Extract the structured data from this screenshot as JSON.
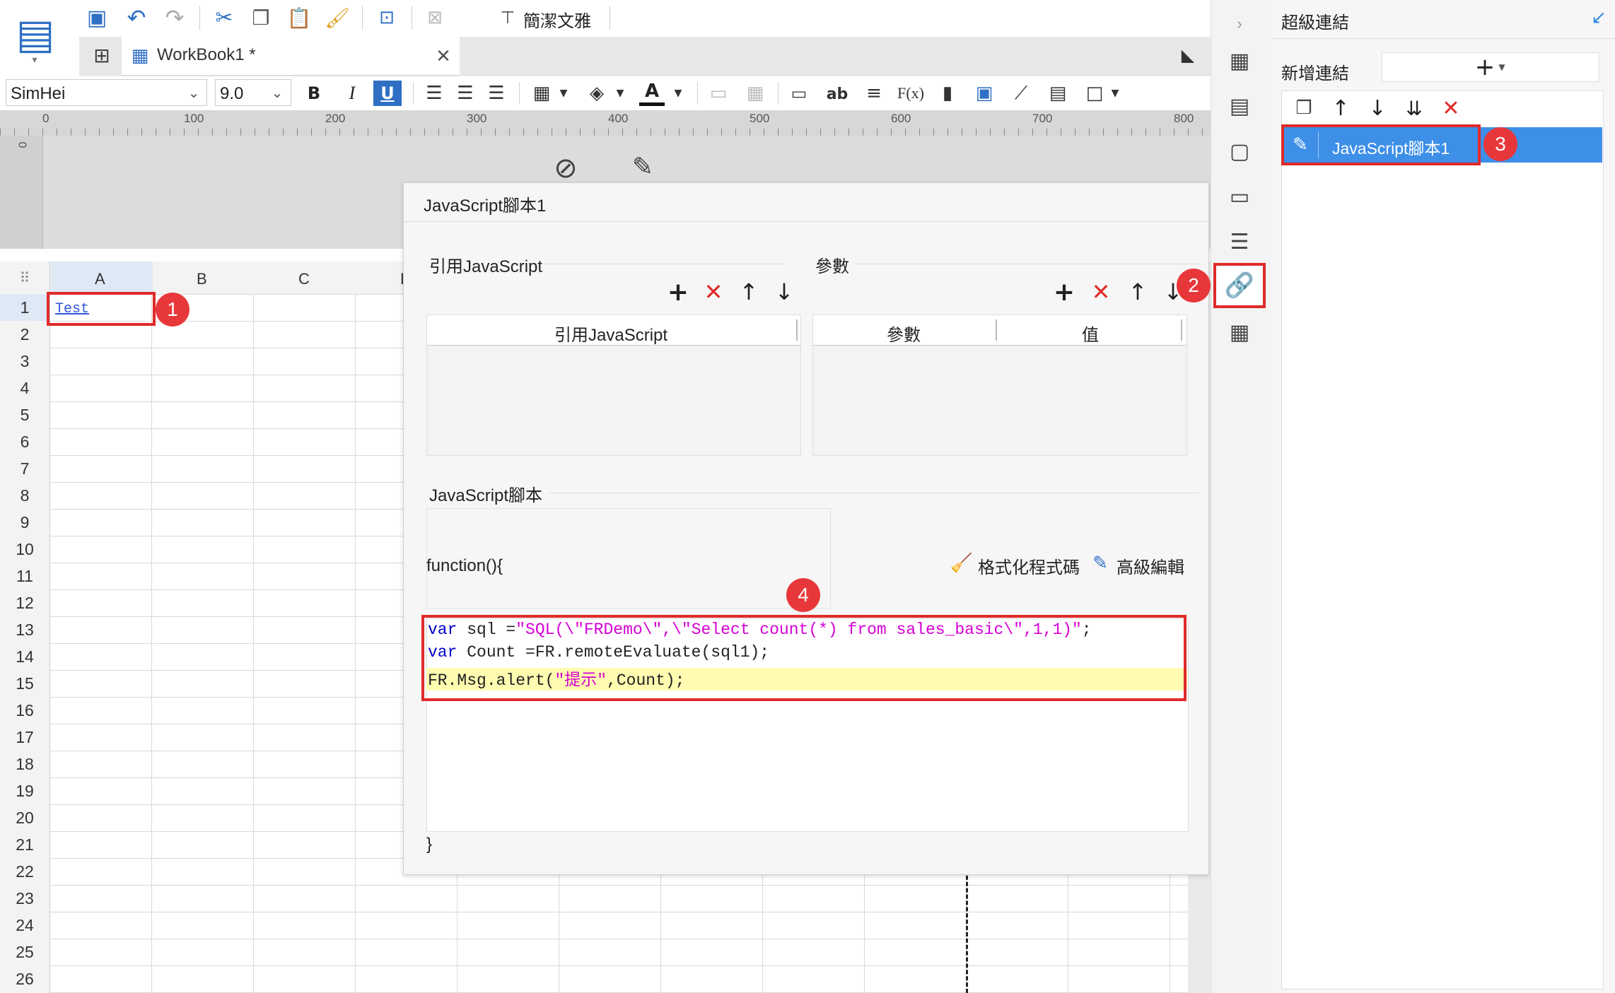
{
  "toolbar1": {
    "tab_label": "WorkBook1 *",
    "style_label": "簡潔文雅"
  },
  "toolbar2": {
    "font_name": "SimHei",
    "font_size": "9.0",
    "bold": "B",
    "italic": "I",
    "underline": "U",
    "text_ab": "ab",
    "formula": "F(x)"
  },
  "ruler": {
    "ticks": [
      "0",
      "100",
      "200",
      "300",
      "400",
      "500",
      "600",
      "700",
      "800"
    ],
    "vertical_label": "0"
  },
  "grid": {
    "columns": [
      "A",
      "B",
      "C",
      "D"
    ],
    "rows": [
      "1",
      "2",
      "3",
      "4",
      "5",
      "6",
      "7",
      "8",
      "9",
      "10",
      "11",
      "12",
      "13",
      "14",
      "15",
      "16",
      "17",
      "18",
      "19",
      "20",
      "21",
      "22",
      "23",
      "24",
      "25",
      "26"
    ],
    "cell_a1": "Test"
  },
  "dialog": {
    "title": "JavaScript腳本1",
    "ref_section": "引用JavaScript",
    "ref_col": "引用JavaScript",
    "param_section": "參數",
    "param_col1": "參數",
    "param_col2": "值",
    "script_section": "JavaScript腳本",
    "function_header": "function(){",
    "format_btn": "格式化程式碼",
    "advanced_btn": "高級編輯",
    "closing_brace": "}",
    "code": {
      "l1_kw": "var",
      "l1_a": " sql =",
      "l1_str": "\"SQL(\\\"FRDemo\\\",\\\"Select count(*) from sales_basic\\\",1,1)\"",
      "l1_end": ";",
      "l2_kw": "var",
      "l2_rest": " Count =FR.remoteEvaluate(sql1);",
      "l3_a": "FR.Msg.alert(",
      "l3_str": "\"提示\"",
      "l3_b": ",Count);"
    }
  },
  "right_panel": {
    "title": "超級連結",
    "add_label": "新增連結",
    "item": "JavaScript腳本1"
  },
  "markers": [
    "1",
    "2",
    "3",
    "4"
  ],
  "colors": {
    "accent": "#2f8ae5",
    "highlight_red": "#e02a2a",
    "selected_item": "#3d8fe8"
  }
}
